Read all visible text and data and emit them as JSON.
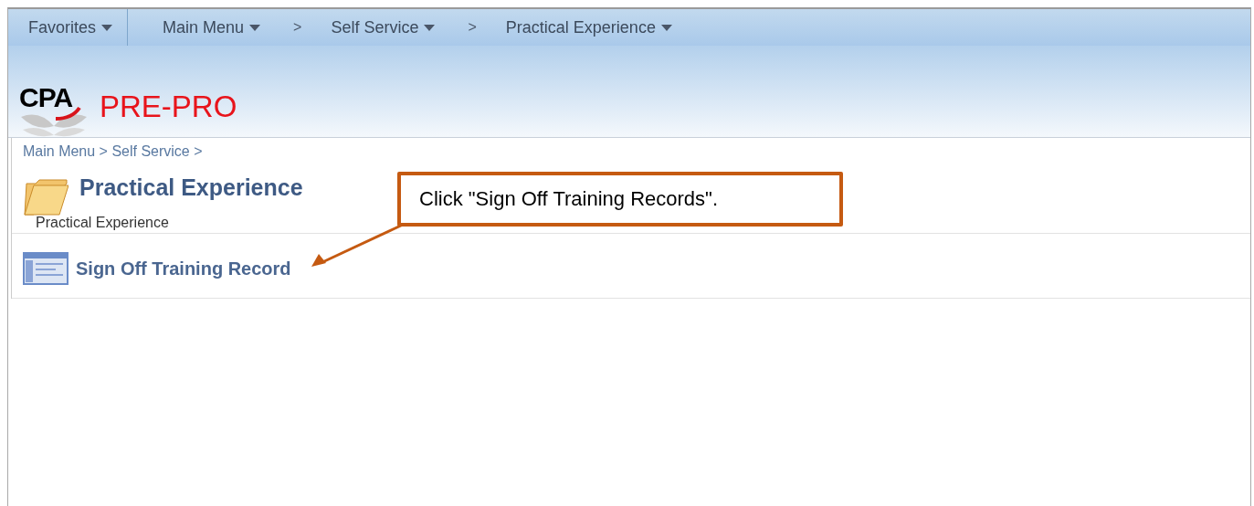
{
  "nav": [
    {
      "kind": "menu",
      "label": "Favorites"
    },
    {
      "kind": "divider"
    },
    {
      "kind": "menu",
      "label": "Main Menu"
    },
    {
      "kind": "separator",
      "label": ">"
    },
    {
      "kind": "menu",
      "label": "Self Service"
    },
    {
      "kind": "separator",
      "label": ">"
    },
    {
      "kind": "menu",
      "label": "Practical Experience"
    }
  ],
  "logo": {
    "acronym": "CPA",
    "name": "PRE-PRO"
  },
  "breadcrumb": "Main Menu > Self Service >",
  "folder": {
    "title": "Practical Experience",
    "description": "Practical Experience"
  },
  "links": [
    {
      "label": "Sign Off Training Record"
    }
  ],
  "callout": {
    "text": "Click \"Sign Off Training Records\"."
  }
}
